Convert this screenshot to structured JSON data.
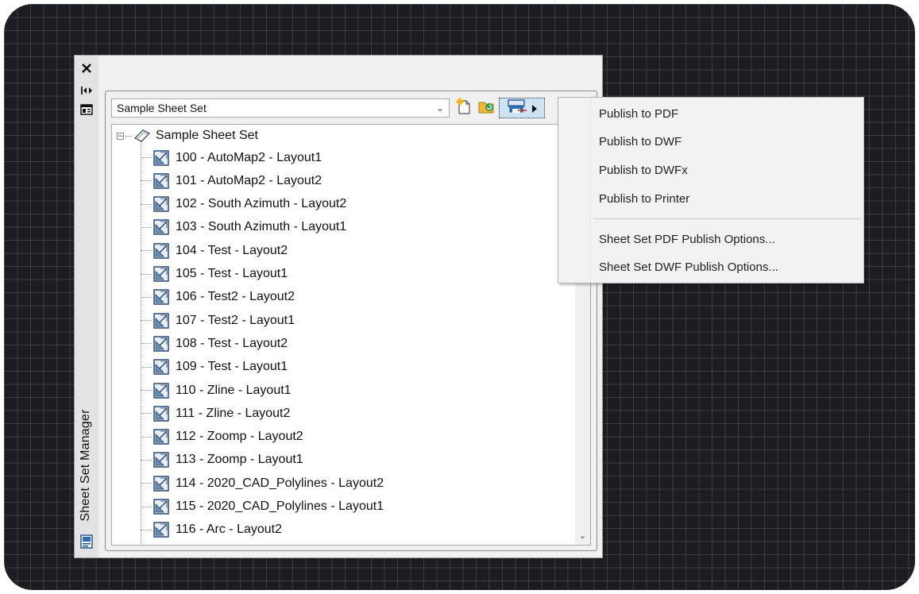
{
  "palette": {
    "title": "Sheet Set Manager",
    "sheet_set_dropdown": {
      "value": "Sample Sheet Set"
    }
  },
  "tree": {
    "root_label": "Sample Sheet Set",
    "sheets": [
      "100 - AutoMap2 - Layout1",
      "101 - AutoMap2 - Layout2",
      "102 - South Azimuth - Layout2",
      "103 - South Azimuth - Layout1",
      "104 - Test - Layout2",
      "105 - Test - Layout1",
      "106 - Test2 - Layout2",
      "107 - Test2 - Layout1",
      "108 - Test - Layout2",
      "109 - Test - Layout1",
      "110 - Zline - Layout1",
      "111 - Zline - Layout2",
      "112 - Zoomp - Layout2",
      "113 - Zoomp - Layout1",
      "114 - 2020_CAD_Polylines - Layout2",
      "115 - 2020_CAD_Polylines - Layout1",
      "116 - Arc - Layout2"
    ]
  },
  "publish_menu": {
    "items": [
      "Publish to PDF",
      "Publish to DWF",
      "Publish to DWFx",
      "Publish to Printer",
      "Sheet Set PDF Publish Options...",
      "Sheet Set DWF Publish Options..."
    ]
  },
  "icons": {
    "close": "close-icon",
    "auto_hide": "auto-hide-icon",
    "properties": "properties-icon",
    "new_sheet": "new-sheet-icon",
    "refresh_status": "refresh-status-icon",
    "publish": "publish-icon",
    "sheet": "sheet-icon",
    "sheet_set": "sheet-set-icon"
  },
  "colors": {
    "canvas_background": "#1b1d20",
    "panel_background": "#f0f0f0",
    "active_button": "#cfe3f7"
  }
}
